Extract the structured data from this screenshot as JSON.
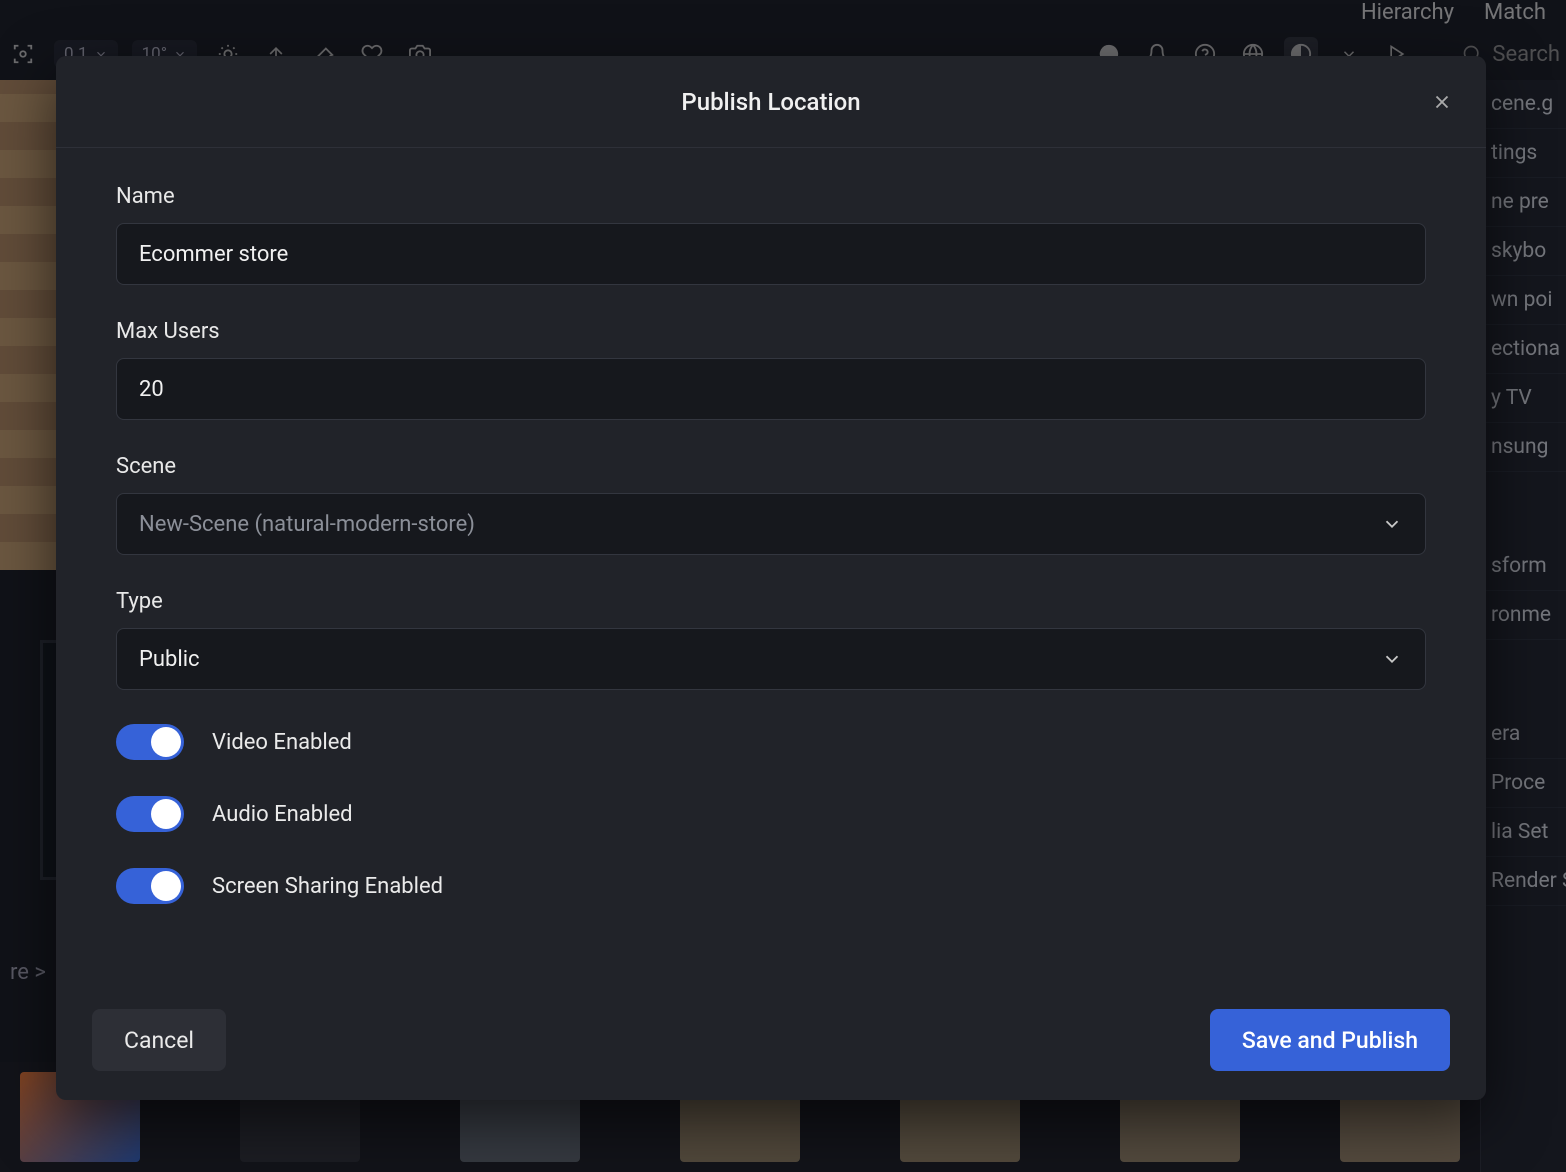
{
  "backgroundApp": {
    "tabs": [
      "Hierarchy",
      "Match"
    ],
    "toolbar": {
      "val1": "0.1",
      "val2": "10°"
    },
    "searchPlaceholder": "Search",
    "breadcrumb_tail": "re  >",
    "rightPanelItems": [
      "cene.g",
      "tings",
      "ne pre",
      "skybo",
      "wn poi",
      "ectiona",
      "y TV",
      "nsung"
    ],
    "rightPanelLower": [
      "sform",
      "ronme"
    ],
    "rightPanelBottom": [
      "era",
      "Proce",
      "lia Set",
      "Render Se"
    ]
  },
  "modal": {
    "title": "Publish Location",
    "fields": {
      "name": {
        "label": "Name",
        "value": "Ecommer store"
      },
      "maxUsers": {
        "label": "Max Users",
        "value": "20"
      },
      "scene": {
        "label": "Scene",
        "value": "New-Scene (natural-modern-store)"
      },
      "type": {
        "label": "Type",
        "value": "Public"
      }
    },
    "toggles": {
      "video": {
        "label": "Video Enabled",
        "on": true
      },
      "audio": {
        "label": "Audio Enabled",
        "on": true
      },
      "screen": {
        "label": "Screen Sharing Enabled",
        "on": true
      }
    },
    "buttons": {
      "cancel": "Cancel",
      "submit": "Save and Publish"
    }
  }
}
